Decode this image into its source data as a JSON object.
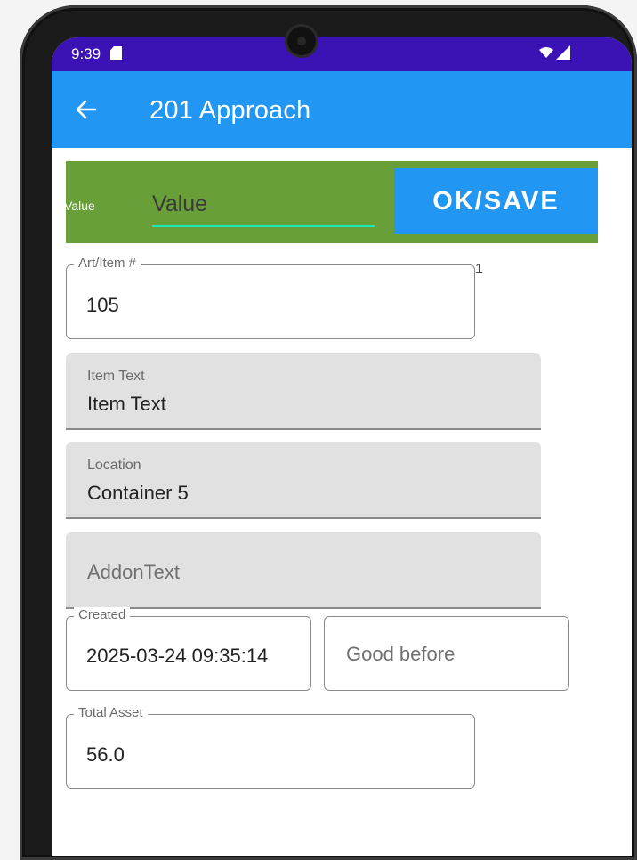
{
  "status_bar": {
    "time": "9:39"
  },
  "app_bar": {
    "title": "201 Approach",
    "back_icon": "arrow-left-icon"
  },
  "value_bar": {
    "label": "Value",
    "input_placeholder": "Value",
    "ok_button_label": "OK/SAVE",
    "background_color": "#689f38",
    "button_color": "#2196f3"
  },
  "form": {
    "art_item": {
      "label": "Art/Item #",
      "value": "105",
      "counter": "1"
    },
    "item_text": {
      "label": "Item Text",
      "value": "Item Text"
    },
    "location": {
      "label": "Location",
      "value": "Container 5"
    },
    "addon_text": {
      "placeholder": "AddonText"
    },
    "created": {
      "label": "Created",
      "value": "2025-03-24 09:35:14"
    },
    "good_before": {
      "placeholder": "Good before"
    },
    "total_asset": {
      "label": "Total Asset",
      "value": "56.0"
    }
  },
  "colors": {
    "status_bar": "#3b13b5",
    "app_bar": "#2196f3",
    "accent": "#1de9b6"
  }
}
